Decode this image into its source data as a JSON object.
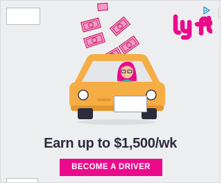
{
  "ad": {
    "brand": "lyft",
    "headline": "Earn up to $1,500/wk",
    "cta_label": "BECOME A DRIVER",
    "icons": [
      "adchoices-icon",
      "lyft-logo",
      "car-illustration",
      "driver-illustration",
      "money-bill-icon"
    ]
  },
  "colors": {
    "background": "#edeef0",
    "brand_pink": "#ea0b8c",
    "car_orange": "#f5ad45",
    "money_pink": "#f49ac8",
    "headline_text": "#2d2b3c"
  }
}
